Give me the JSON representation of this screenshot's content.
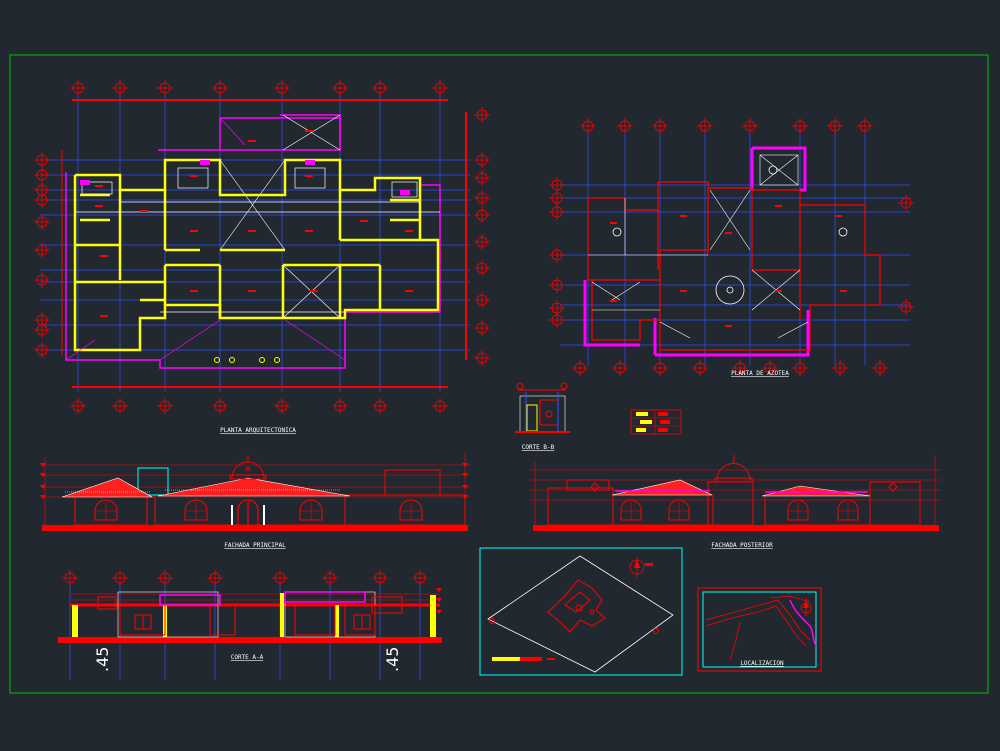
{
  "drawing": {
    "labels": {
      "plan_arquitectonica": "PLANTA ARQUITECTONICA",
      "plan_azotea": "PLANTA DE AZOTEA",
      "corte_bb": "CORTE B-B",
      "fachada_principal": "FACHADA PRINCIPAL",
      "fachada_posterior": "FACHADA POSTERIOR",
      "corte_aa": "CORTE A-A",
      "localizacion": "LOCALIZACION",
      "level_left": ".45",
      "level_right": ".45"
    },
    "colors": {
      "background": "#212830",
      "border": "#00c000",
      "wall": "#ffff00",
      "red": "#ff0000",
      "magenta": "#ff00ff",
      "cyan": "#00ffff",
      "white": "#ffffff",
      "blue": "#2f4fff"
    }
  }
}
